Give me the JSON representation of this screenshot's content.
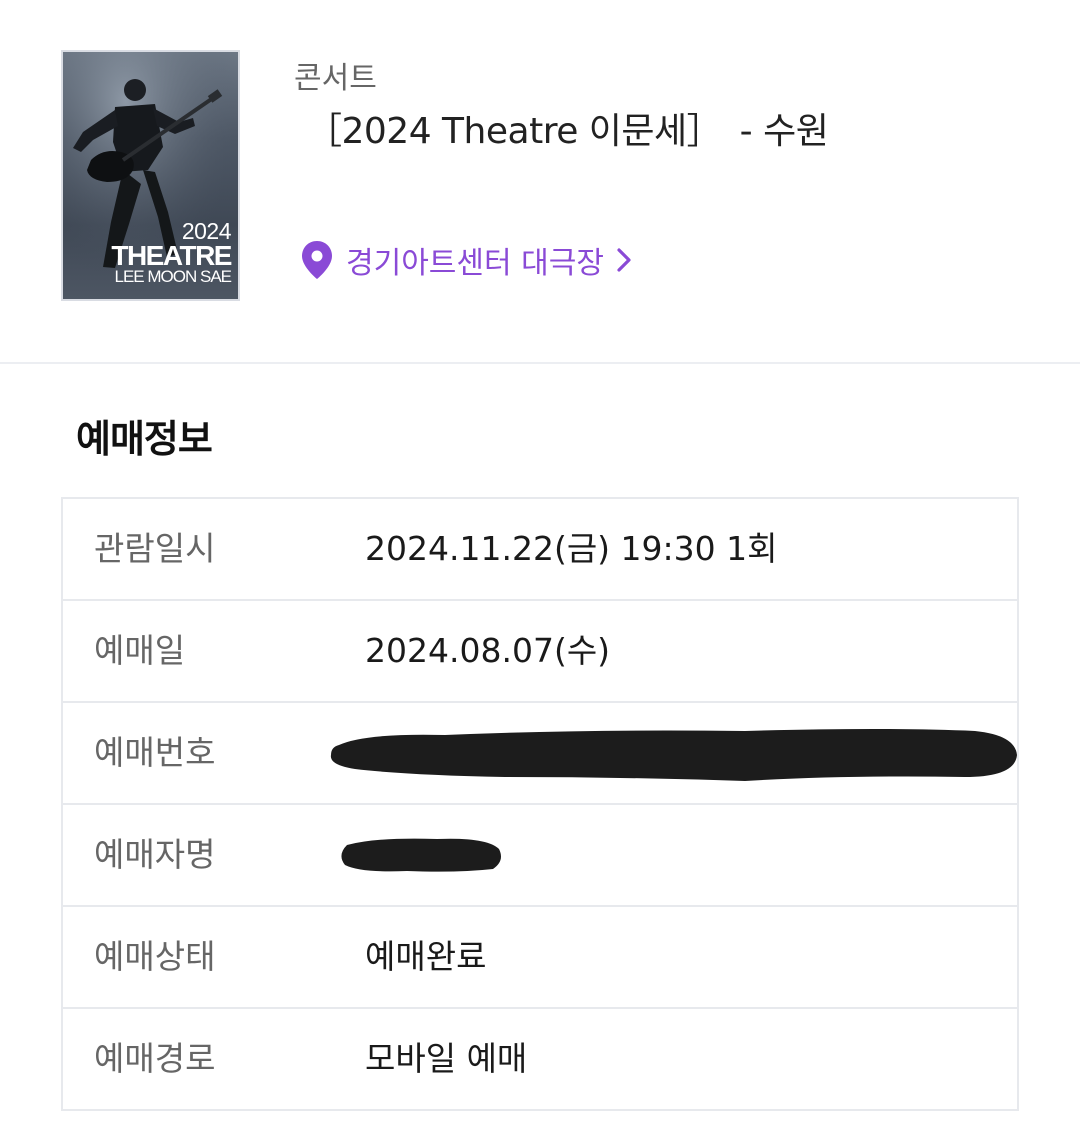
{
  "event": {
    "category": "콘서트",
    "title": "［2024 Theatre 이문세］　- 수원",
    "venue": "경기아트센터 대극장",
    "poster": {
      "year": "2024",
      "title": "THEATRE",
      "artist": "LEE MOON SAE"
    }
  },
  "booking_info": {
    "section_title": "예매정보",
    "rows": [
      {
        "label": "관람일시",
        "value": "2024.11.22(금) 19:30 1회"
      },
      {
        "label": "예매일",
        "value": "2024.08.07(수)"
      },
      {
        "label": "예매번호",
        "value": ""
      },
      {
        "label": "예매자명",
        "value": ""
      },
      {
        "label": "예매상태",
        "value": "예매완료"
      },
      {
        "label": "예매경로",
        "value": "모바일 예매"
      }
    ]
  },
  "colors": {
    "accent": "#8a4ad6",
    "label_text": "#666666",
    "border": "#e7e9ed",
    "redaction": "#1c1c1c"
  },
  "icons": {
    "venue_icon": "location-pin-icon",
    "venue_arrow": "chevron-right-icon"
  }
}
